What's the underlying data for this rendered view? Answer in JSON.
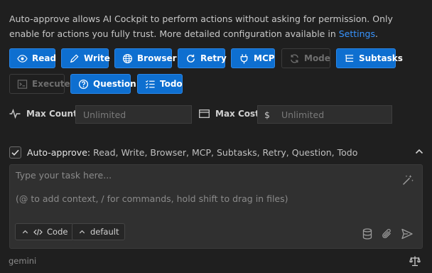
{
  "description": {
    "text": "Auto-approve allows AI Cockpit to perform actions without asking for permission. Only enable for actions you fully trust. More detailed configuration available in ",
    "link": "Settings",
    "suffix": "."
  },
  "permissions": [
    {
      "label": "Read",
      "icon": "eye-icon",
      "enabled": true
    },
    {
      "label": "Write",
      "icon": "pencil-icon",
      "enabled": true
    },
    {
      "label": "Browser",
      "icon": "globe-icon",
      "enabled": true
    },
    {
      "label": "Retry",
      "icon": "refresh-icon",
      "enabled": true
    },
    {
      "label": "MCP",
      "icon": "plug-icon",
      "enabled": true
    },
    {
      "label": "Mode",
      "icon": "sync-icon",
      "enabled": false
    },
    {
      "label": "Subtasks",
      "icon": "list-tree-icon",
      "enabled": true
    },
    {
      "label": "Execute",
      "icon": "terminal-icon",
      "enabled": false
    },
    {
      "label": "Question",
      "icon": "question-icon",
      "enabled": true
    },
    {
      "label": "Todo",
      "icon": "checklist-icon",
      "enabled": true
    }
  ],
  "limits": {
    "max_count_label": "Max Count:",
    "max_count_placeholder": "Unlimited",
    "max_cost_label": "Max Cost:",
    "currency": "$",
    "max_cost_placeholder": "Unlimited"
  },
  "auto_approve": {
    "checked": true,
    "label": "Auto-approve:",
    "summary": "Read, Write, Browser, MCP, Subtasks, Retry, Question, Todo"
  },
  "task_input": {
    "placeholder_line1": "Type your task here...",
    "placeholder_line2": "(@ to add context, / for commands, hold shift to drag in files)"
  },
  "mode_selector": {
    "label": "Code"
  },
  "profile_selector": {
    "label": "default"
  },
  "footer": {
    "model": "gemini"
  },
  "colors": {
    "accent": "#0e6fd0",
    "link": "#3794ff",
    "background": "#1f1f1f"
  }
}
